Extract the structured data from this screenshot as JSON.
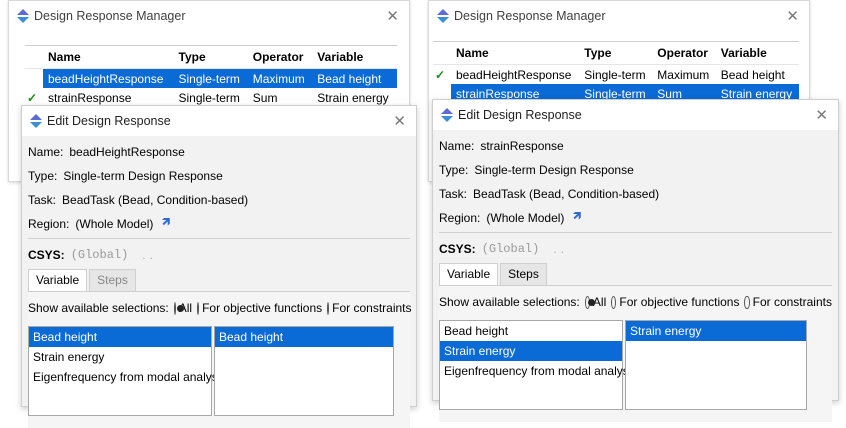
{
  "left": {
    "manager": {
      "title": "Design Response Manager",
      "columns": [
        "Name",
        "Type",
        "Operator",
        "Variable"
      ],
      "rows": [
        {
          "check": "✓",
          "name": "beadHeightResponse",
          "type": "Single-term",
          "operator": "Maximum",
          "variable": "Bead height",
          "selected": true
        },
        {
          "check": "✓",
          "name": "strainResponse",
          "type": "Single-term",
          "operator": "Sum",
          "variable": "Strain energy",
          "selected": false
        }
      ]
    },
    "edit": {
      "title": "Edit Design Response",
      "name_label": "Name:",
      "name_value": "beadHeightResponse",
      "type_label": "Type:",
      "type_value": "Single-term Design Response",
      "task_label": "Task:",
      "task_value": "BeadTask (Bead, Condition-based)",
      "region_label": "Region:",
      "region_value": "(Whole Model)",
      "csys_label": "CSYS:",
      "csys_value": "(Global)",
      "tabs": [
        "Variable",
        "Steps"
      ],
      "show_label": "Show available selections:",
      "radio_all": "All",
      "radio_objective": "For objective functions",
      "radio_constraints": "For constraints",
      "available": [
        "Bead height",
        "Strain energy",
        "Eigenfrequency from modal analysis"
      ],
      "selected_index": 0,
      "chosen": "Bead height"
    }
  },
  "right": {
    "manager": {
      "title": "Design Response Manager",
      "columns": [
        "Name",
        "Type",
        "Operator",
        "Variable"
      ],
      "rows": [
        {
          "check": "✓",
          "name": "beadHeightResponse",
          "type": "Single-term",
          "operator": "Maximum",
          "variable": "Bead height",
          "selected": false
        },
        {
          "check": "✓",
          "name": "strainResponse",
          "type": "Single-term",
          "operator": "Sum",
          "variable": "Strain energy",
          "selected": true
        }
      ]
    },
    "edit": {
      "title": "Edit Design Response",
      "name_label": "Name:",
      "name_value": "strainResponse",
      "type_label": "Type:",
      "type_value": "Single-term Design Response",
      "task_label": "Task:",
      "task_value": "BeadTask (Bead, Condition-based)",
      "region_label": "Region:",
      "region_value": "(Whole Model)",
      "csys_label": "CSYS:",
      "csys_value": "(Global)",
      "tabs": [
        "Variable",
        "Steps"
      ],
      "show_label": "Show available selections:",
      "radio_all": "All",
      "radio_objective": "For objective functions",
      "radio_constraints": "For constraints",
      "available": [
        "Bead height",
        "Strain energy",
        "Eigenfrequency from modal analysis"
      ],
      "selected_index": 1,
      "chosen": "Strain energy"
    }
  },
  "colors": {
    "selection": "#0a6ad6",
    "check": "#1e8a1e",
    "dialog_bg": "#f2f2f2"
  },
  "icons": {
    "app": "abaqus-logo-icon",
    "close": "close-icon",
    "region_pick": "cursor-arrow-icon"
  }
}
